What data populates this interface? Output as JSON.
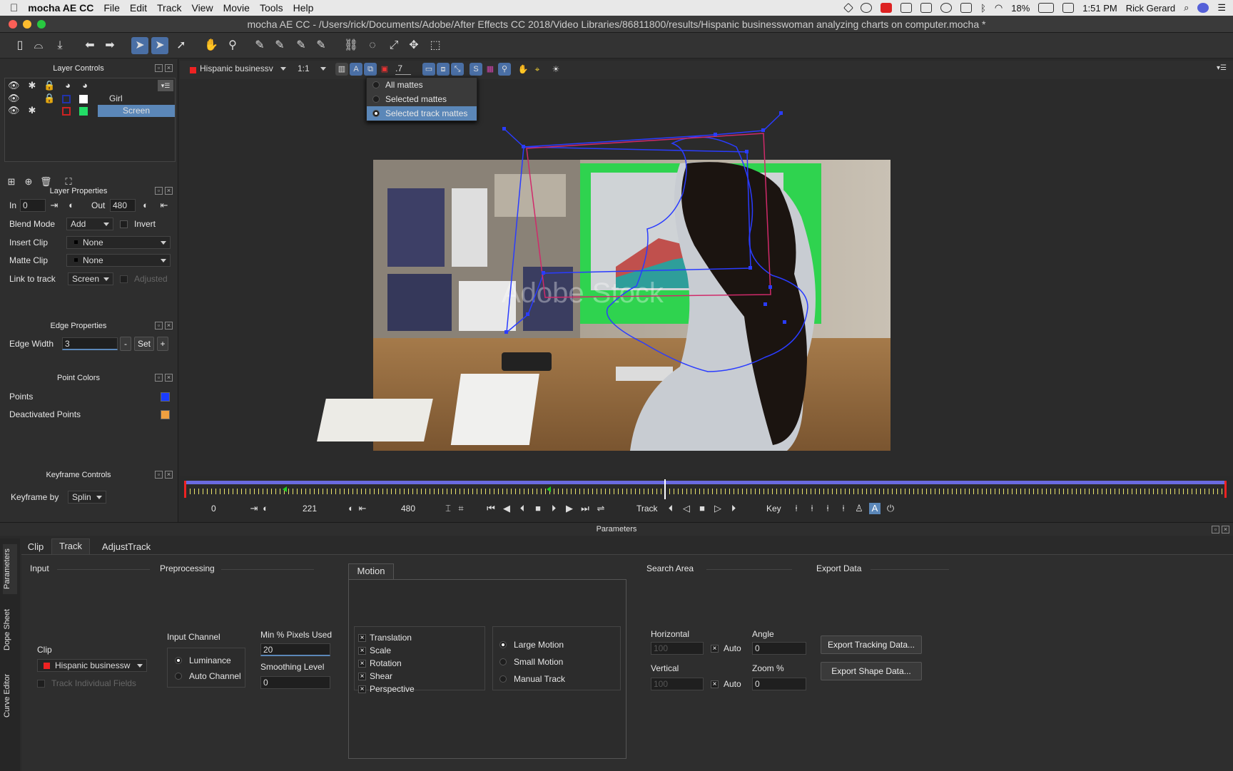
{
  "menubar": {
    "apple": "",
    "app": "mocha AE CC",
    "items": [
      "File",
      "Edit",
      "Track",
      "View",
      "Movie",
      "Tools",
      "Help"
    ],
    "battery": "18%",
    "clock": "1:51 PM",
    "user": "Rick Gerard"
  },
  "window": {
    "title": "mocha AE CC - /Users/rick/Documents/Adobe/After Effects CC 2018/Video Libraries/86811800/results/Hispanic businesswoman analyzing charts on computer.mocha *"
  },
  "layer_controls": {
    "title": "Layer Controls",
    "layers": [
      {
        "name": "Girl",
        "color": "#2233aa"
      },
      {
        "name": "Screen",
        "color": "#cc2222"
      }
    ]
  },
  "layer_properties": {
    "title": "Layer Properties",
    "in_label": "In",
    "in_value": "0",
    "out_label": "Out",
    "out_value": "480",
    "blend_label": "Blend Mode",
    "blend_value": "Add",
    "invert_label": "Invert",
    "insert_label": "Insert Clip",
    "insert_value": "None",
    "matte_label": "Matte Clip",
    "matte_value": "None",
    "link_label": "Link to track",
    "link_value": "Screen",
    "adjusted_label": "Adjusted"
  },
  "edge_properties": {
    "title": "Edge Properties",
    "width_label": "Edge Width",
    "width_value": "3",
    "minus": "-",
    "set": "Set",
    "plus": "+"
  },
  "point_colors": {
    "title": "Point Colors",
    "points_label": "Points",
    "points_color": "#1a3cff",
    "deact_label": "Deactivated Points",
    "deact_color": "#f0a040"
  },
  "keyframe_controls": {
    "title": "Keyframe Controls",
    "by_label": "Keyframe by",
    "by_value": "Splin"
  },
  "viewer": {
    "clip": "Hispanic businessv",
    "zoom": "1:1",
    "opacity": ".7",
    "matte_menu": [
      "All mattes",
      "Selected mattes",
      "Selected track mattes"
    ],
    "matte_selected": 2,
    "watermark": "Adobe Stock"
  },
  "timeline": {
    "start": "0",
    "current": "221",
    "end": "480",
    "track_label": "Track",
    "key_label": "Key",
    "playhead_fraction": 0.46
  },
  "parameters": {
    "title": "Parameters",
    "side_tabs": [
      "Parameters",
      "Dope Sheet",
      "Curve Editor"
    ],
    "tabs": [
      "Clip",
      "Track",
      "AdjustTrack"
    ],
    "active_tab": "Track",
    "input": {
      "title": "Input",
      "clip_label": "Clip",
      "clip_value": "Hispanic businessw",
      "track_fields": "Track Individual Fields"
    },
    "preprocessing": {
      "title": "Preprocessing",
      "channel_label": "Input Channel",
      "luminance": "Luminance",
      "auto_channel": "Auto Channel",
      "min_label": "Min % Pixels Used",
      "min_value": "20",
      "smooth_label": "Smoothing Level",
      "smooth_value": "0"
    },
    "motion": {
      "title": "Motion",
      "options": [
        "Translation",
        "Scale",
        "Rotation",
        "Shear",
        "Perspective"
      ],
      "modes": [
        "Large Motion",
        "Small Motion",
        "Manual Track"
      ],
      "mode_selected": 0
    },
    "search_area": {
      "title": "Search Area",
      "horizontal": "Horizontal",
      "h_value": "100",
      "vertical": "Vertical",
      "v_value": "100",
      "auto": "Auto",
      "angle": "Angle",
      "angle_value": "0",
      "zoom": "Zoom %",
      "zoom_value": "0"
    },
    "export": {
      "title": "Export Data",
      "tracking": "Export Tracking Data...",
      "shape": "Export Shape Data..."
    }
  }
}
